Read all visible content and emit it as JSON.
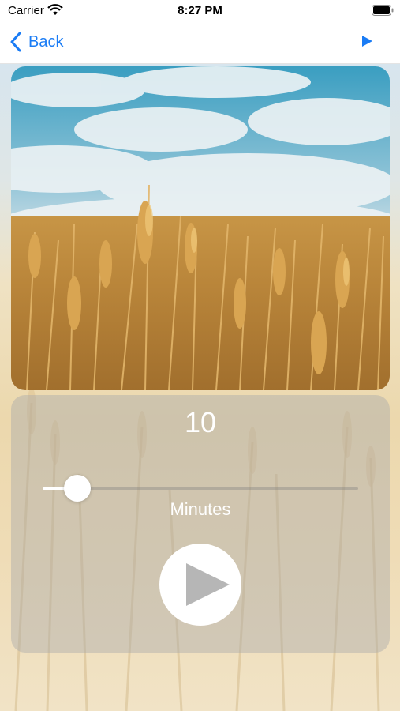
{
  "status_bar": {
    "carrier": "Carrier",
    "time": "8:27 PM",
    "icons": [
      "wifi-icon",
      "battery-icon"
    ]
  },
  "nav": {
    "back_label": "Back",
    "back_icon": "chevron-left-icon",
    "play_icon": "play-icon",
    "accent_color": "#1a7cf5"
  },
  "timer": {
    "duration_value": "10",
    "unit_label": "Minutes",
    "slider_fraction": 0.11,
    "play_icon": "play-icon"
  }
}
